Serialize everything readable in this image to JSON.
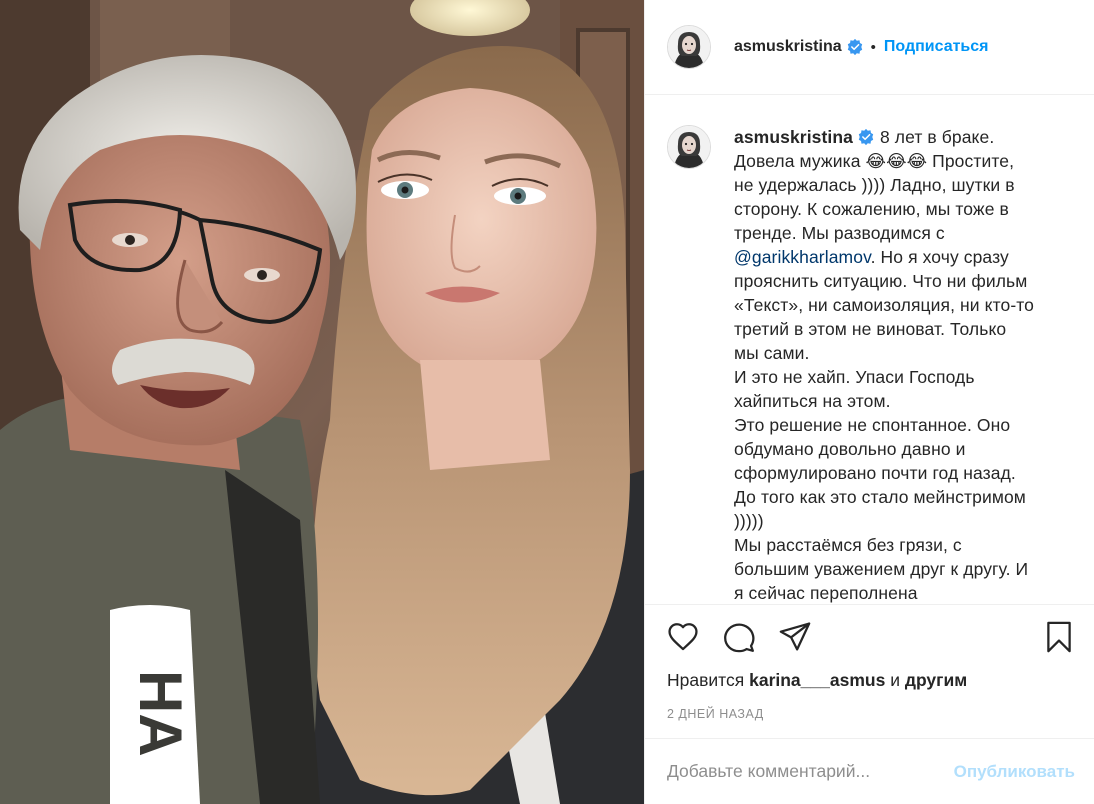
{
  "post": {
    "username": "asmuskristina",
    "follow_label": "Подписаться",
    "dot": "•",
    "caption_lines": [
      "8 лет в браке.",
      "Довела мужика 😂😂😂 Простите,",
      "не удержалась )))) Ладно, шутки в",
      "сторону. К сожалению, мы тоже в",
      "тренде. Мы разводимся с",
      "@garikkharlamov",
      ". Но я хочу сразу",
      "прояснить ситуацию. Что ни фильм",
      "«Текст», ни самоизоляция, ни кто-то",
      "третий в этом не виноват. Только",
      "мы сами.",
      "И это не хайп. Упаси Господь",
      "хайпиться на этом.",
      "Это решение не спонтанное. Оно",
      "обдумано довольно давно и",
      "сформулировано почти год назад.",
      "До того как это стало мейнстримом",
      ")))))",
      "Мы расстаёмся без грязи, с",
      "большим уважением друг к другу. И",
      "я сейчас переполнена"
    ],
    "likes_prefix": "Нравится",
    "likes_user": "karina___asmus",
    "likes_and": "и",
    "likes_others": "другим",
    "date": "2 дней назад",
    "comment_placeholder": "Добавьте комментарий...",
    "publish_label": "Опубликовать"
  },
  "icons": {
    "like": "heart-icon",
    "comment": "comment-icon",
    "share": "send-icon",
    "save": "bookmark-icon",
    "verified": "verified-badge-icon"
  },
  "colors": {
    "accent": "#0095f6",
    "publish_disabled": "#b2dffc",
    "mention": "#00376b",
    "muted": "#8e8e8e",
    "text": "#262626"
  }
}
